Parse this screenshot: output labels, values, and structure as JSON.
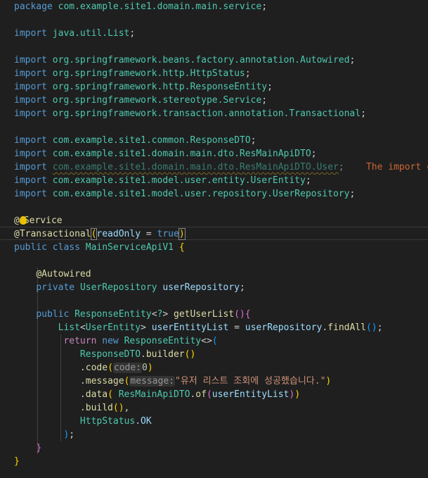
{
  "editor": {
    "package_kw": "package",
    "package_name": "com.example.site1.domain.main.service",
    "import_kw": "import",
    "imports": [
      "java.util.List",
      "org.springframework.beans.factory.annotation.Autowired",
      "org.springframework.http.HttpStatus",
      "org.springframework.http.ResponseEntity",
      "org.springframework.stereotype.Service",
      "org.springframework.transaction.annotation.Transactional",
      "com.example.site1.common.ResponseDTO",
      "com.example.site1.domain.main.dto.ResMainApiDTO",
      "com.example.site1.domain.main.dto.ResMainApiDTO.User",
      "com.example.site1.model.user.entity.UserEntity",
      "com.example.site1.model.user.repository.UserRepository"
    ],
    "unused_import_warning": "The import co",
    "service_annotation": "Service",
    "transactional_annotation": "Transactional",
    "readonly_param": "readOnly",
    "true_literal": "true",
    "class_decl": "public class",
    "class_name": "MainServiceApiV1",
    "autowired": "Autowired",
    "private_kw": "private",
    "repo_type": "UserRepository",
    "repo_field": "userRepository",
    "public_kw": "public",
    "response_entity": "ResponseEntity",
    "wildcard": "?",
    "method_name": "getUserList",
    "list_type": "List",
    "user_entity": "UserEntity",
    "list_var": "userEntityList",
    "find_all": "findAll",
    "return_kw": "return",
    "new_kw": "new",
    "response_dto": "ResponseDTO",
    "builder": "builder",
    "code_method": "code",
    "code_hint": "code:",
    "code_value": "0",
    "message_method": "message",
    "message_hint": "message:",
    "message_value": "\"유저 리스트 조회에 성공했습니다.\"",
    "data_method": "data",
    "res_dto": "ResMainApiDTO",
    "of_method": "of",
    "build_method": "build",
    "http_status": "HttpStatus",
    "ok_const": "OK"
  }
}
